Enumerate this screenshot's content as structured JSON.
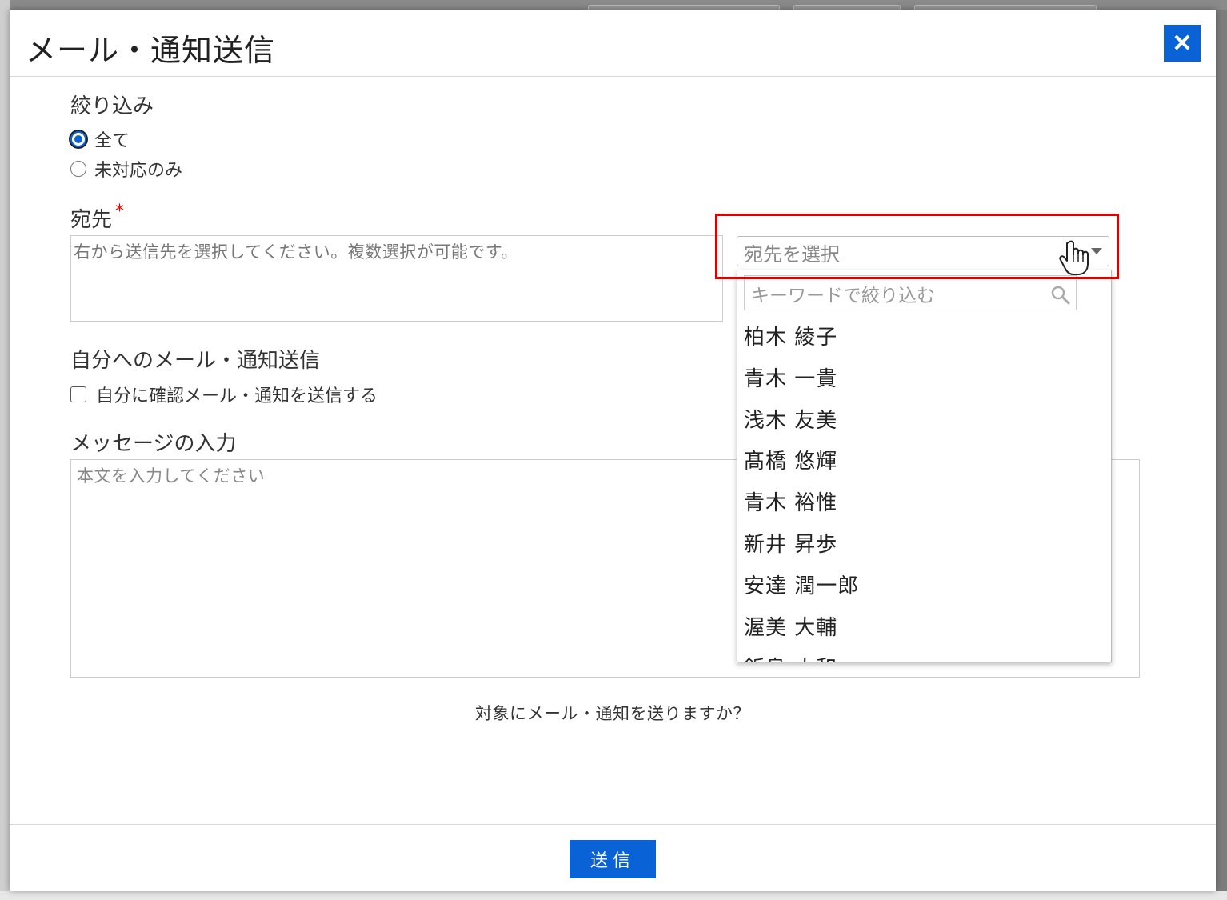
{
  "modal": {
    "title": "メール・通知送信",
    "close_label": "✕"
  },
  "filter": {
    "label": "絞り込み",
    "options": [
      {
        "label": "全て",
        "checked": true
      },
      {
        "label": "未対応のみ",
        "checked": false
      }
    ]
  },
  "recipients": {
    "label": "宛先",
    "required_mark": "*",
    "placeholder": "右から送信先を選択してください。複数選択が可能です。",
    "select_placeholder": "宛先を選択",
    "filter_placeholder": "キーワードで絞り込む",
    "options": [
      "柏木 綾子",
      "青木 一貴",
      "浅木 友美",
      "髙橋 悠輝",
      "青木 裕惟",
      "新井 昇歩",
      "安達 潤一郎",
      "渥美 大輔",
      "飯島 大和"
    ]
  },
  "self_send": {
    "label": "自分へのメール・通知送信",
    "checkbox_label": "自分に確認メール・通知を送信する",
    "checked": false
  },
  "message": {
    "label": "メッセージの入力",
    "placeholder": "本文を入力してください"
  },
  "confirm_text": "対象にメール・通知を送りますか？",
  "send_label": "送信",
  "colors": {
    "primary": "#0a63d6",
    "highlight": "#e00000",
    "required": "#e00000"
  }
}
